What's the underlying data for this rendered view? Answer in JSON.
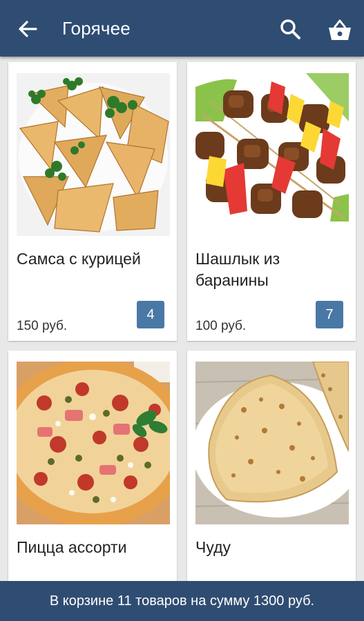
{
  "header": {
    "title": "Горячее",
    "back_icon": "arrow-left-icon",
    "search_icon": "search-icon",
    "cart_icon": "basket-icon"
  },
  "products": [
    {
      "name": "Самса с курицей",
      "price": "150 руб.",
      "quantity": "4",
      "image": "samsa-photo"
    },
    {
      "name": "Шашлык из баранины",
      "price": "100 руб.",
      "quantity": "7",
      "image": "shashlik-photo"
    },
    {
      "name": "Пицца ассорти",
      "image": "pizza-photo"
    },
    {
      "name": "Чуду",
      "image": "chudu-photo"
    }
  ],
  "footer": {
    "cart_summary": "В корзине 11 товаров на сумму 1300 руб."
  },
  "colors": {
    "primary": "#2f4d72",
    "accent": "#4a78a6",
    "background": "#e8e8e8"
  }
}
